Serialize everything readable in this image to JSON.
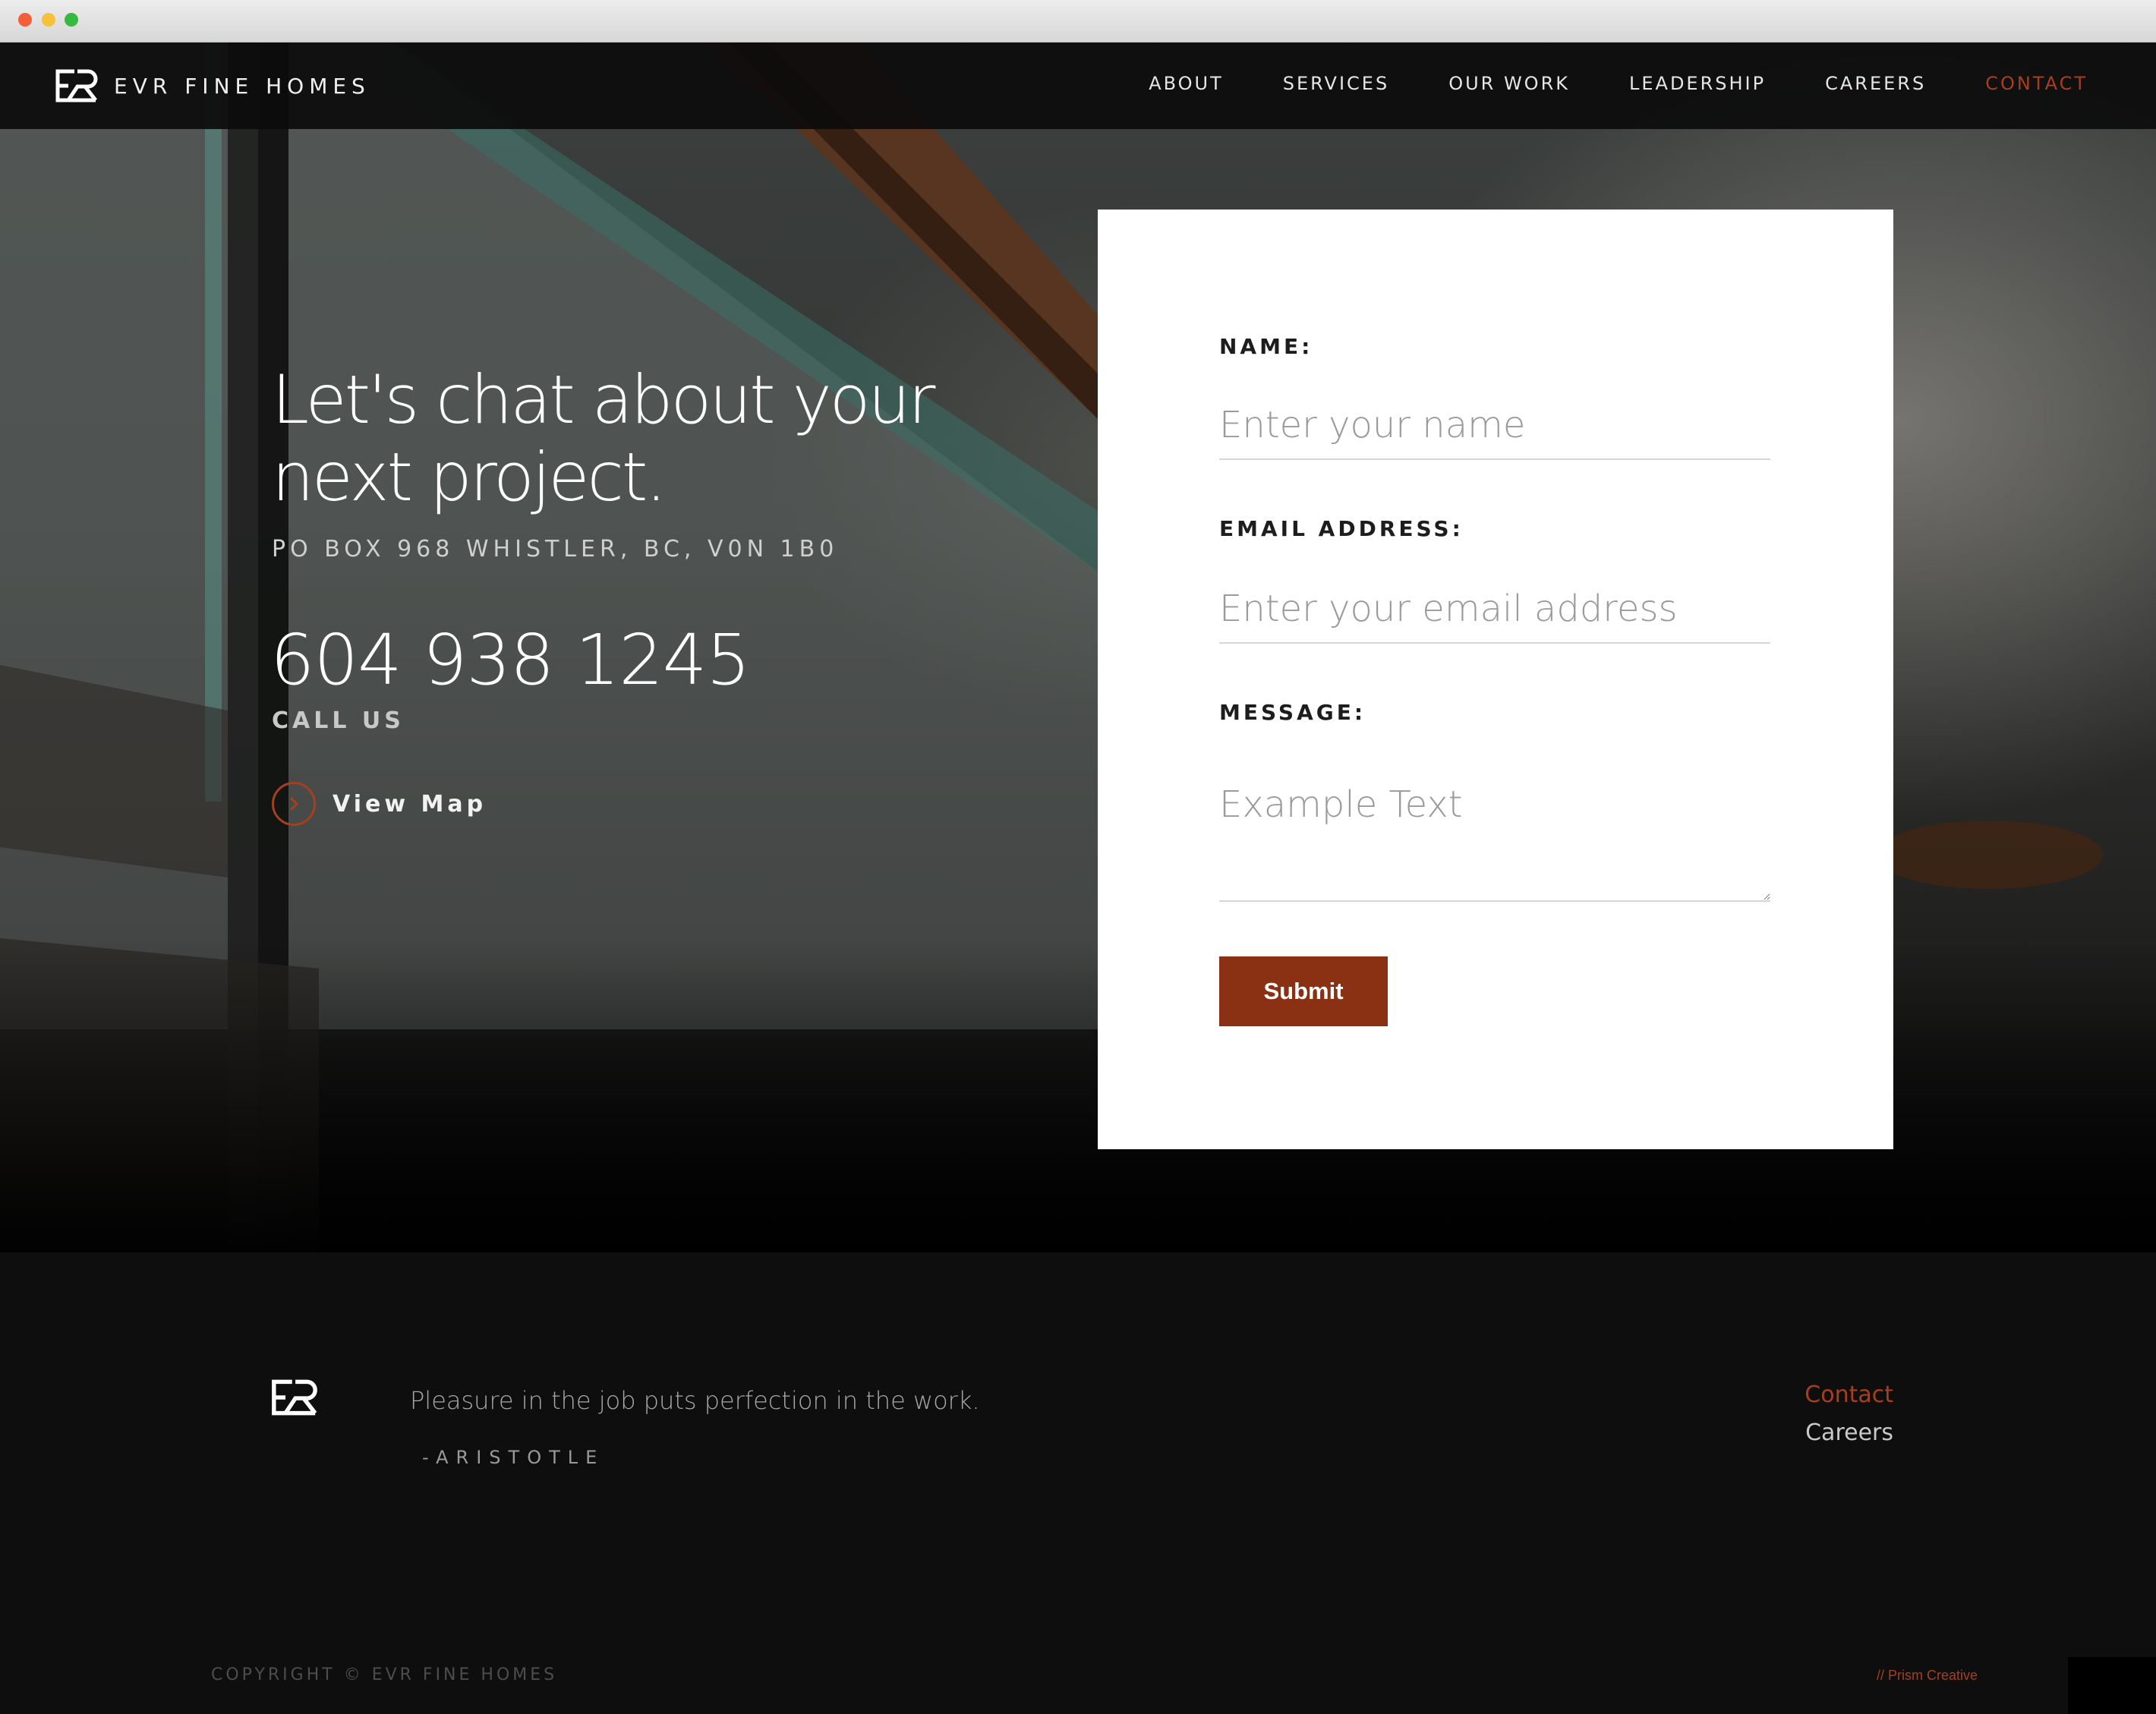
{
  "brand": {
    "name": "EVR FINE HOMES",
    "logo_icon": "evr-monogram-icon"
  },
  "nav": {
    "items": [
      {
        "label": "ABOUT",
        "active": false
      },
      {
        "label": "SERVICES",
        "active": false
      },
      {
        "label": "OUR WORK",
        "active": false
      },
      {
        "label": "LEADERSHIP",
        "active": false
      },
      {
        "label": "CAREERS",
        "active": false
      },
      {
        "label": "CONTACT",
        "active": true
      }
    ]
  },
  "hero": {
    "headline_line1": "Let's chat about your",
    "headline_line2": "next project.",
    "address": "PO BOX 968 WHISTLER, BC, V0N 1B0",
    "phone": "604 938 1245",
    "call_label": "CALL US",
    "view_map_label": "View Map",
    "view_map_icon": "chevron-right-circle-icon"
  },
  "form": {
    "name_label": "NAME:",
    "name_placeholder": "Enter your name",
    "name_value": "",
    "email_label": "EMAIL ADDRESS:",
    "email_placeholder": "Enter your email address",
    "email_value": "",
    "message_label": "MESSAGE:",
    "message_placeholder": "Example Text",
    "message_value": "",
    "submit_label": "Submit"
  },
  "footer": {
    "quote": "Pleasure in the job puts perfection in the work.",
    "quote_author": "-ARISTOTLE",
    "links": [
      {
        "label": "Contact",
        "active": true
      },
      {
        "label": "Careers",
        "active": false
      }
    ],
    "copyright": "COPYRIGHT © EVR FINE HOMES",
    "credit": "// Prism Creative"
  },
  "colors": {
    "accent": "#a63f1e",
    "button": "#8b3113",
    "navbar_bg": "#0c0c0c",
    "footer_bg": "#0e0e0e"
  }
}
